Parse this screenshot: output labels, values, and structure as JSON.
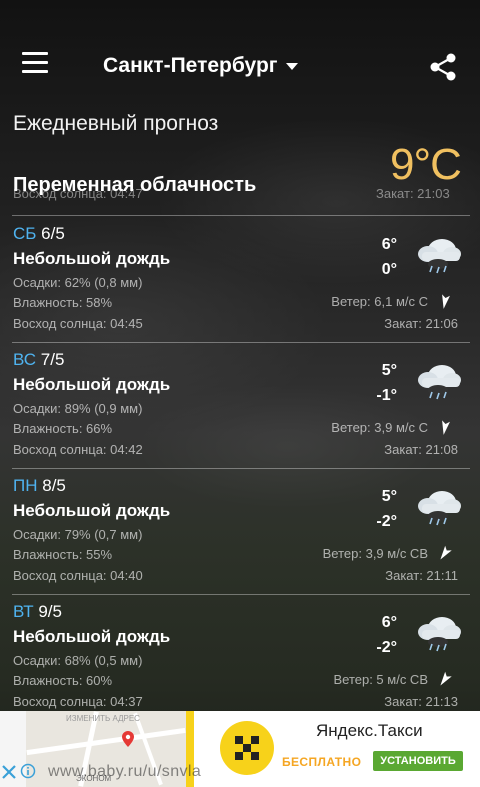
{
  "header": {
    "city": "Санкт-Петербург"
  },
  "forecast_title": "Ежедневный прогноз",
  "current": {
    "temp": "9°C",
    "condition": "Переменная облачность",
    "ghost_left": "Восход солнца: 04:47",
    "ghost_right": "Закат: 21:03"
  },
  "days": [
    {
      "dow": "СБ",
      "date": "6/5",
      "condition": "Небольшой дождь",
      "precip": "Осадки: 62% (0,8 мм)",
      "humidity": "Влажность: 58%",
      "sunrise": "Восход солнца: 04:45",
      "high": "6°",
      "low": "0°",
      "wind": "Ветер: 6,1 м/с С",
      "sunset": "Закат: 21:06",
      "wind_dir": "N"
    },
    {
      "dow": "ВС",
      "date": "7/5",
      "condition": "Небольшой дождь",
      "precip": "Осадки: 89% (0,9 мм)",
      "humidity": "Влажность: 66%",
      "sunrise": "Восход солнца: 04:42",
      "high": "5°",
      "low": "-1°",
      "wind": "Ветер: 3,9 м/с С",
      "sunset": "Закат: 21:08",
      "wind_dir": "N"
    },
    {
      "dow": "ПН",
      "date": "8/5",
      "condition": "Небольшой дождь",
      "precip": "Осадки: 79% (0,7 мм)",
      "humidity": "Влажность: 55%",
      "sunrise": "Восход солнца: 04:40",
      "high": "5°",
      "low": "-2°",
      "wind": "Ветер: 3,9 м/с СВ",
      "sunset": "Закат: 21:11",
      "wind_dir": "NE"
    },
    {
      "dow": "ВТ",
      "date": "9/5",
      "condition": "Небольшой дождь",
      "precip": "Осадки: 68% (0,5 мм)",
      "humidity": "Влажность: 60%",
      "sunrise": "Восход солнца: 04:37",
      "high": "6°",
      "low": "-2°",
      "wind": "Ветер: 5 м/с СВ",
      "sunset": "Закат: 21:13",
      "wind_dir": "NE"
    }
  ],
  "ad": {
    "map_street": "ИЗМЕНИТЬ АДРЕС",
    "map_bottom": "ЭКОНОМ",
    "brand": "Яндекс.Такси",
    "free_label": "БЕСПЛАТНО",
    "install_label": "УСТАНОВИТЬ",
    "watermark": "www.baby.ru/u/snvla"
  },
  "colors": {
    "accent_blue": "#4fb3f0",
    "current_temp": "#f0c060",
    "taxi_yellow": "#f7d21a",
    "install_green": "#5aa832"
  }
}
